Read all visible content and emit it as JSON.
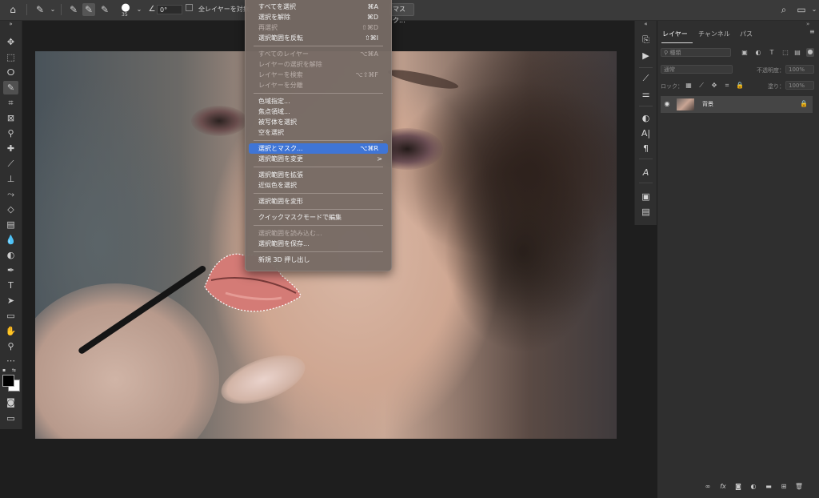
{
  "options_bar": {
    "size_value": "35",
    "angle_value": "0°",
    "sample_all_layers": "全レイヤーを対象",
    "select_and_mask_button": "マスク..."
  },
  "menu": {
    "items": [
      {
        "label": "すべてを選択",
        "shortcut": "⌘A",
        "state": "enabled"
      },
      {
        "label": "選択を解除",
        "shortcut": "⌘D",
        "state": "enabled"
      },
      {
        "label": "再選択",
        "shortcut": "⇧⌘D",
        "state": "disabled"
      },
      {
        "label": "選択範囲を反転",
        "shortcut": "⇧⌘I",
        "state": "enabled"
      },
      {
        "label": "すべてのレイヤー",
        "shortcut": "⌥⌘A",
        "state": "disabled"
      },
      {
        "label": "レイヤーの選択を解除",
        "shortcut": "",
        "state": "disabled"
      },
      {
        "label": "レイヤーを検索",
        "shortcut": "⌥⇧⌘F",
        "state": "disabled"
      },
      {
        "label": "レイヤーを分離",
        "shortcut": "",
        "state": "disabled"
      },
      {
        "label": "色域指定...",
        "shortcut": "",
        "state": "enabled"
      },
      {
        "label": "焦点領域...",
        "shortcut": "",
        "state": "enabled"
      },
      {
        "label": "被写体を選択",
        "shortcut": "",
        "state": "enabled"
      },
      {
        "label": "空を選択",
        "shortcut": "",
        "state": "enabled"
      },
      {
        "label": "選択とマスク...",
        "shortcut": "⌥⌘R",
        "state": "selected"
      },
      {
        "label": "選択範囲を変更",
        "shortcut": "",
        "state": "enabled",
        "submenu": ">"
      },
      {
        "label": "選択範囲を拡張",
        "shortcut": "",
        "state": "enabled"
      },
      {
        "label": "近似色を選択",
        "shortcut": "",
        "state": "enabled"
      },
      {
        "label": "選択範囲を変形",
        "shortcut": "",
        "state": "enabled"
      },
      {
        "label": "クイックマスクモードで編集",
        "shortcut": "",
        "state": "enabled"
      },
      {
        "label": "選択範囲を読み込む...",
        "shortcut": "",
        "state": "disabled"
      },
      {
        "label": "選択範囲を保存...",
        "shortcut": "",
        "state": "enabled"
      },
      {
        "label": "新規 3D 押し出し",
        "shortcut": "",
        "state": "enabled"
      }
    ]
  },
  "layers_panel": {
    "tabs": [
      "レイヤー",
      "チャンネル",
      "パス"
    ],
    "filter_kind": "種類",
    "blend_mode": "通常",
    "opacity_label": "不透明度：",
    "opacity_value": "100%",
    "lock_label": "ロック：",
    "fill_label": "塗り：",
    "fill_value": "100%",
    "layer_name": "背景"
  },
  "colors": {
    "menu_highlight": "#3f75d6",
    "panel_bg": "#2f2f2f",
    "app_bg": "#1e1e1e"
  }
}
